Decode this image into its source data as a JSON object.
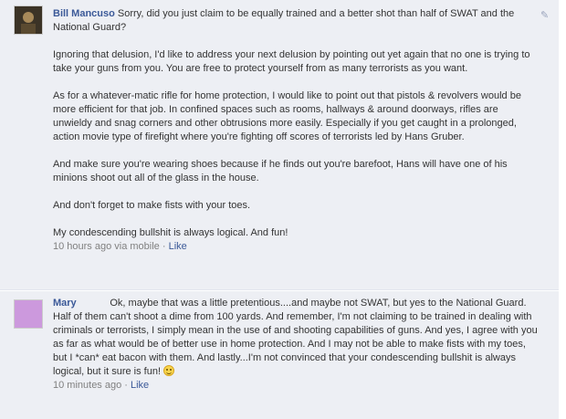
{
  "comments": [
    {
      "author": "Bill Mancuso",
      "avatar_color": "#3b3326",
      "paragraphs": [
        "Sorry, did you just claim to be equally trained and a better shot than half of SWAT and the National Guard?",
        "Ignoring that delusion, I'd like to address your next delusion by pointing out yet again that no one is trying to take your guns from you. You are free to protect yourself from as many terrorists as you want.",
        "As for a whatever-matic rifle for home protection, I would like to point out that pistols & revolvers would be more efficient for that job. In confined spaces such as rooms, hallways & around doorways, rifles are unwieldy and snag corners and other obtrusions more easily. Especially if you get caught in a prolonged, action movie type of firefight where you're fighting off scores of terrorists led by Hans Gruber.",
        "And make sure you're wearing shoes because if he finds out you're barefoot, Hans will have one of his minions shoot out all of the glass in the house.",
        "And don't forget to make fists with your toes.",
        "My condescending bullshit is always logical. And fun!"
      ],
      "time": "10 hours ago via mobile",
      "separator": " · ",
      "like": "Like"
    },
    {
      "author": "Mary",
      "avatar_color": "#cc99dd",
      "text": "Ok, maybe that was a little pretentious....and maybe not SWAT, but yes to the National Guard. Half of them can't shoot a dime from 100 yards. And remember, I'm not claiming to be trained in dealing with criminals or terrorists, I simply mean in the use of and shooting capabilities of guns. And yes, I agree with you as far as what would be of better use in home protection. And I may not be able to make fists with my toes, but I *can* eat bacon with them. And lastly...I'm not convinced that your condescending bullshit is always logical, but it sure is fun!",
      "emoji": "smiley",
      "time": "10 minutes ago",
      "separator": " · ",
      "like": "Like"
    }
  ]
}
